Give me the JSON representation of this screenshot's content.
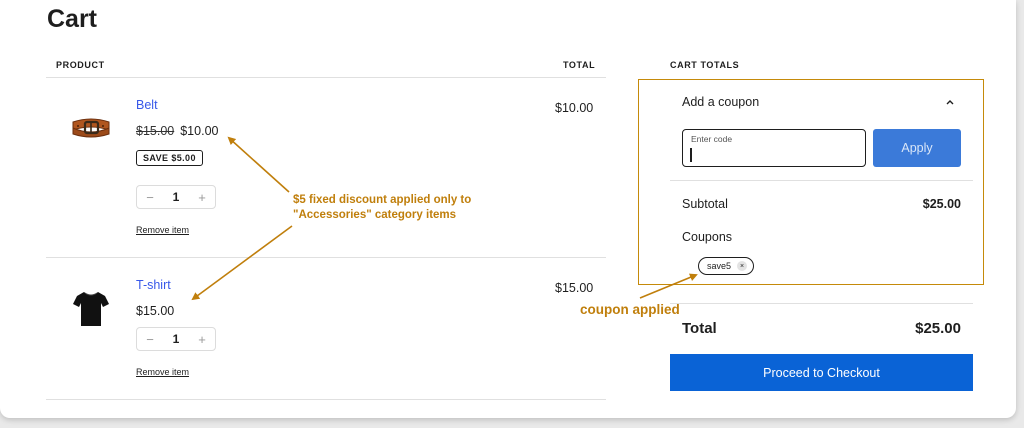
{
  "page": {
    "title": "Cart"
  },
  "cart": {
    "col_product": "PRODUCT",
    "col_total": "TOTAL",
    "items": [
      {
        "name": "Belt",
        "old_price": "$15.00",
        "price": "$10.00",
        "badge": "SAVE $5.00",
        "qty_minus": "−",
        "qty": "1",
        "qty_plus": "+",
        "remove": "Remove item",
        "line_total": "$10.00",
        "icon": "belt-icon"
      },
      {
        "name": "T-shirt",
        "price": "$15.00",
        "qty_minus": "−",
        "qty": "1",
        "qty_plus": "+",
        "remove": "Remove item",
        "line_total": "$15.00",
        "icon": "tshirt-icon"
      }
    ]
  },
  "totals": {
    "heading": "CART TOTALS",
    "add_coupon": "Add a coupon",
    "coupon_placeholder_label": "Enter code",
    "apply": "Apply",
    "subtotal_label": "Subtotal",
    "subtotal_value": "$25.00",
    "coupons_label": "Coupons",
    "coupon_chip": "save5",
    "chip_remove": "×",
    "total_label": "Total",
    "total_value": "$25.00",
    "checkout": "Proceed to Checkout"
  },
  "annotations": {
    "discount_line1": "$5 fixed discount applied only to",
    "discount_line2": "\"Accessories\" category items",
    "coupon_applied": "coupon applied"
  },
  "colors": {
    "link": "#3858e9",
    "primary_button": "#0a63d6",
    "annotation": "#c07f0c"
  }
}
